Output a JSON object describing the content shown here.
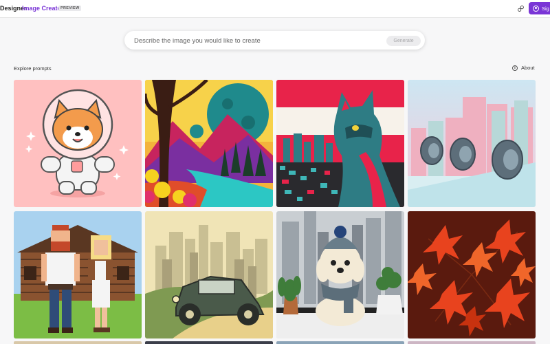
{
  "header": {
    "brand": "Designer",
    "product": "Image Creator",
    "badge": "PREVIEW",
    "share_icon": "share-icon",
    "signin_label": "Sig",
    "accent": "#7a35d6"
  },
  "search": {
    "placeholder": "Describe the image you would like to create",
    "button": "Generate"
  },
  "explore": {
    "label": "Explore prompts",
    "about": "About"
  },
  "gallery": {
    "tiles": [
      {
        "subject": "astronaut-shiba"
      },
      {
        "subject": "psychedelic-forest-landscape"
      },
      {
        "subject": "cat-over-city"
      },
      {
        "subject": "giant-tires-city"
      },
      {
        "subject": "pixel-art-couple-cabin"
      },
      {
        "subject": "vintage-car-city"
      },
      {
        "subject": "knitted-dog-window"
      },
      {
        "subject": "red-maple-leaves"
      }
    ]
  }
}
